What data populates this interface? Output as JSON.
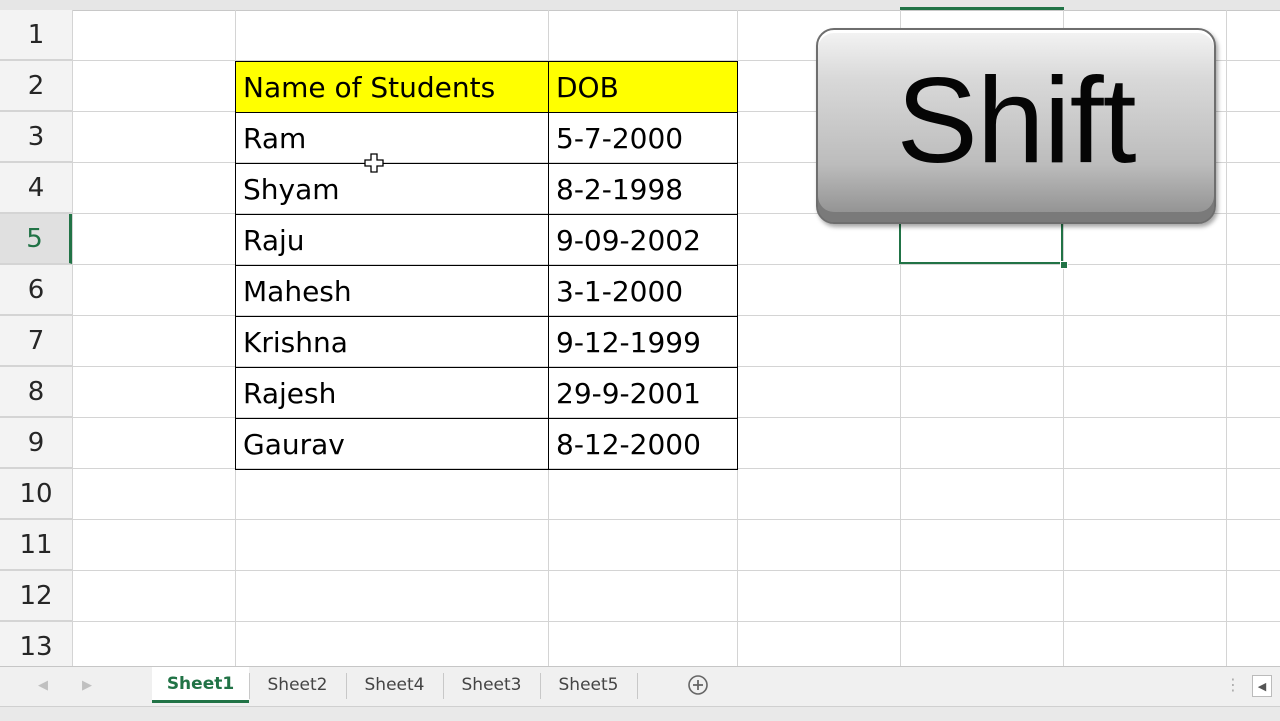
{
  "sheet": {
    "row_numbers": [
      "1",
      "2",
      "3",
      "4",
      "5",
      "6",
      "7",
      "8",
      "9",
      "10",
      "11",
      "12",
      "13"
    ],
    "active_row": "5",
    "table": {
      "headers": [
        "Name of Students",
        "DOB"
      ],
      "rows": [
        [
          "Ram",
          "5-7-2000"
        ],
        [
          "Shyam",
          "8-2-1998"
        ],
        [
          "Raju",
          "9-09-2002"
        ],
        [
          "Mahesh",
          "3-1-2000"
        ],
        [
          "Krishna",
          "9-12-1999"
        ],
        [
          "Rajesh",
          "29-9-2001"
        ],
        [
          "Gaurav",
          "8-12-2000"
        ]
      ],
      "header_fill": "#ffff00"
    },
    "selection_color": "#217346"
  },
  "key_overlay": {
    "label": "Shift"
  },
  "tabs": {
    "items": [
      "Sheet1",
      "Sheet2",
      "Sheet4",
      "Sheet3",
      "Sheet5"
    ],
    "active": "Sheet1",
    "add_icon": "plus-circle-icon"
  }
}
